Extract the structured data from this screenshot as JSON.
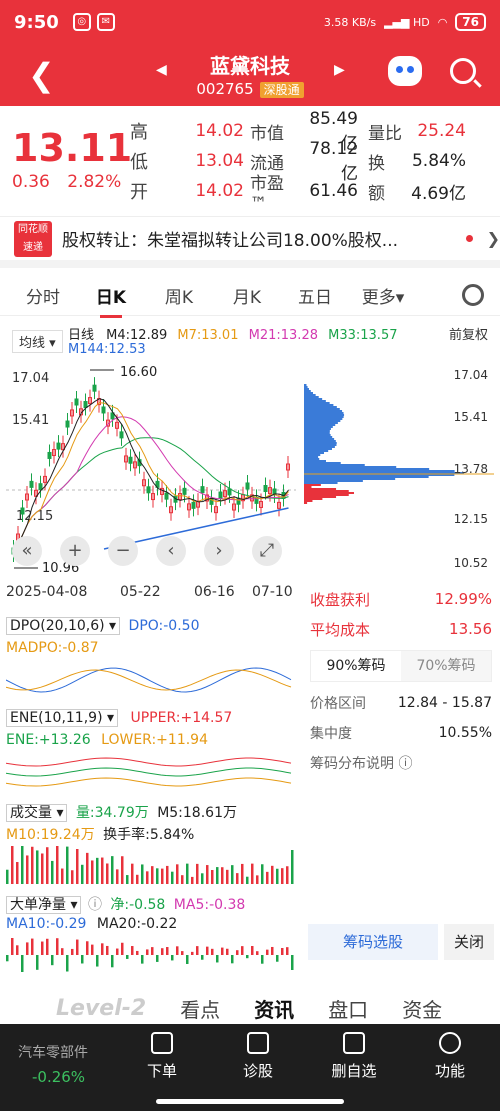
{
  "status": {
    "time": "9:50",
    "speed": "3.58 KB/s",
    "battery": "76"
  },
  "header": {
    "name": "蓝黛科技",
    "code": "002765",
    "tag": "深股通"
  },
  "quote": {
    "price": "13.11",
    "change": "0.36",
    "change_pct": "2.82%",
    "rows": [
      {
        "l": "高",
        "v": "14.02",
        "l2": "市值",
        "v2": "85.49亿",
        "l3": "量比",
        "v3": "25.24"
      },
      {
        "l": "低",
        "v": "13.04",
        "l2": "流通",
        "v2": "78.12亿",
        "l3": "换",
        "v3": "5.84%"
      },
      {
        "l": "开",
        "v": "14.02",
        "l2": "市盈™",
        "v2": "61.46",
        "l3": "额",
        "v3": "4.69亿"
      }
    ]
  },
  "news": {
    "source": "同花顺 速递",
    "text": "股权转让：朱堂福拟转让公司18.00%股权..."
  },
  "tabs": [
    "分时",
    "日K",
    "周K",
    "月K",
    "五日",
    "更多▾"
  ],
  "legend": {
    "ma_select": "均线 ▾",
    "period": "日线",
    "m4": "M4:12.89",
    "m7": "M7:13.01",
    "m21": "M21:13.28",
    "m33": "M33:13.57",
    "m144": "M144:12.53",
    "fq": "前复权"
  },
  "price_axis": {
    "top": "17.04",
    "mid": "15.41",
    "low": "12.15",
    "high_mark": "16.60",
    "low_mark": "10.96"
  },
  "x_axis": [
    "2025-04-08",
    "05-22",
    "06-16",
    "07-10"
  ],
  "chip_axis": [
    "17.04",
    "15.41",
    "13.78",
    "12.15",
    "10.52"
  ],
  "chips": {
    "profit_label": "收盘获利",
    "profit": "12.99%",
    "cost_label": "平均成本",
    "cost": "13.56",
    "tab1": "90%筹码",
    "tab2": "70%筹码",
    "range_label": "价格区间",
    "range": "12.84 - 15.87",
    "conc_label": "集中度",
    "conc": "10.55%",
    "explain": "筹码分布说明 ⓘ",
    "select": "筹码选股",
    "close": "关闭"
  },
  "dpo": {
    "name": "DPO(20,10,6) ▾",
    "dpo": "DPO:-0.50",
    "madpo": "MADPO:-0.87"
  },
  "ene": {
    "name": "ENE(10,11,9) ▾",
    "upper": "UPPER:+14.57",
    "ene": "ENE:+13.26",
    "lower": "LOWER:+11.94"
  },
  "vol": {
    "name": "成交量 ▾",
    "liang": "量:34.79万",
    "m5": "M5:18.61万",
    "m10": "M10:19.24万",
    "hsl": "换手率:5.84%"
  },
  "ddjl": {
    "name": "大单净量 ▾",
    "jing": "净:-0.58",
    "ma5": "MA5:-0.38",
    "ma10": "MA10:-0.29",
    "ma20": "MA20:-0.22"
  },
  "bottom_tabs": [
    "Level-2",
    "看点",
    "资讯",
    "盘口",
    "资金"
  ],
  "nav": {
    "sector": "汽车零部件",
    "sector_chg": "-0.26%",
    "items": [
      "下单",
      "诊股",
      "删自选",
      "功能"
    ]
  },
  "colors": {
    "red": "#e8323b",
    "green": "#1aa34a",
    "blue": "#2d6bd8",
    "orange": "#f0a030",
    "magenta": "#d33ab0"
  }
}
